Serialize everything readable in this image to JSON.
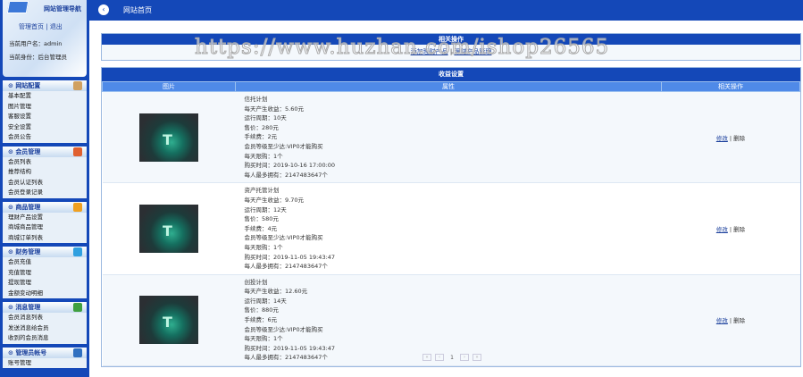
{
  "sidebar": {
    "title": "网站管理导航",
    "home": "管理首页",
    "logout": "退出",
    "user": "当前用户名：admin",
    "role": "当前身份：后台管理员",
    "sections": [
      {
        "title": "网站配置",
        "color": "#d0a060",
        "items": [
          "基本配置",
          "图片管理",
          "客服设置",
          "安全设置",
          "会员公告"
        ]
      },
      {
        "title": "会员管理",
        "color": "#e06030",
        "items": [
          "会员列表",
          "推荐结构",
          "会员认证列表",
          "会员登录记录"
        ]
      },
      {
        "title": "商品管理",
        "color": "#f0a020",
        "items": [
          "理财产品设置",
          "商城商品管理",
          "商城订单列表"
        ]
      },
      {
        "title": "财务管理",
        "color": "#30a0e0",
        "items": [
          "会员充值",
          "充值管理",
          "提现管理",
          "金额变动明细"
        ]
      },
      {
        "title": "消息管理",
        "color": "#40a040",
        "items": [
          "会员消息列表",
          "发送消息给会员",
          "收到的会员消息"
        ]
      },
      {
        "title": "管理员帐号",
        "color": "#3070c0",
        "items": [
          "账号管理"
        ]
      }
    ]
  },
  "topbar": {
    "title": "网站首页"
  },
  "ops_panel": {
    "title": "相关操作",
    "link1": "添加理财产品",
    "sep": "|",
    "link2": "理财产品管理"
  },
  "income": {
    "title": "收益设置",
    "headers": [
      "图片",
      "属性",
      "相关操作"
    ],
    "edit": "修改",
    "del": "删除",
    "sep": "|",
    "rows": [
      {
        "attrs": [
          "信托计划",
          "每天产生收益：5.60元",
          "运行周期：10天",
          "售价：280元",
          "手续费：2元",
          "会员等级至少达:VIP0才能购买",
          "每天限购：1个",
          "购买时间：2019-10-16 17:00:00",
          "每人最多拥有：2147483647个"
        ]
      },
      {
        "attrs": [
          "资产托管计划",
          "每天产生收益：9.70元",
          "运行周期：12天",
          "售价：580元",
          "手续费：4元",
          "会员等级至少达:VIP0才能购买",
          "每天限购：1个",
          "购买时间：2019-11-05 19:43:47",
          "每人最多拥有：2147483647个"
        ]
      },
      {
        "attrs": [
          "创投计划",
          "每天产生收益：12.60元",
          "运行周期：14天",
          "售价：880元",
          "手续费：6元",
          "会员等级至少达:VIP0才能购买",
          "每天限购：1个",
          "购买时间：2019-11-05 19:43:47",
          "每人最多拥有：2147483647个"
        ]
      }
    ]
  },
  "pager": {
    "first": "«",
    "prev": "‹",
    "current": "1",
    "next": "›",
    "last": "»"
  },
  "watermark": "https://www.huzhan.com/ishop26565"
}
